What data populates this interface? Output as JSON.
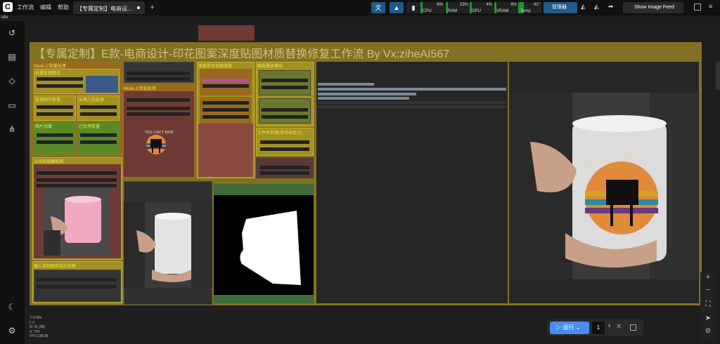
{
  "menu": {
    "workflow": "工作流",
    "edit": "编辑",
    "help": "帮助"
  },
  "tab": {
    "title": "【专属定制】电商设..."
  },
  "status": {
    "idle": "Idle"
  },
  "monitors": [
    {
      "label": "CPU",
      "value": "6%"
    },
    {
      "label": "RAM",
      "value": "23%"
    },
    {
      "label": "GPU",
      "value": "4%"
    },
    {
      "label": "VRAM",
      "value": "8%"
    },
    {
      "label": "Temp",
      "value": "41°"
    }
  ],
  "toolbar": {
    "manager": "管理器",
    "show_feed": "Show Image Feed"
  },
  "group": {
    "title": "【专属定制】E款-电商设计-印花图案深度贴图材质替换修复工作流 By Vx:ziheAI567"
  },
  "nodes": {
    "mode1": "Mode 1:批量处理",
    "batch_path": "批量处理路径",
    "process_count": "处理图片数量",
    "from_n": "从第几张处理",
    "load_img": "图片加载",
    "load_count": "已处理数量",
    "mode2": "Mode 2:单张处理",
    "pattern_opt": "图案是否无缝拼接",
    "output_path": "输出路径模块",
    "file_prefix": "文件名前缀(手动自定义)",
    "upload_product": "上传商品模板图",
    "input_name": "输入待贴图商品的名称"
  },
  "run": {
    "label": "运行",
    "qty": "1"
  },
  "stats": [
    "T: 0.00s",
    "I: 0",
    "N: 41 [38]",
    "V: 734",
    "FPS:138.89"
  ]
}
